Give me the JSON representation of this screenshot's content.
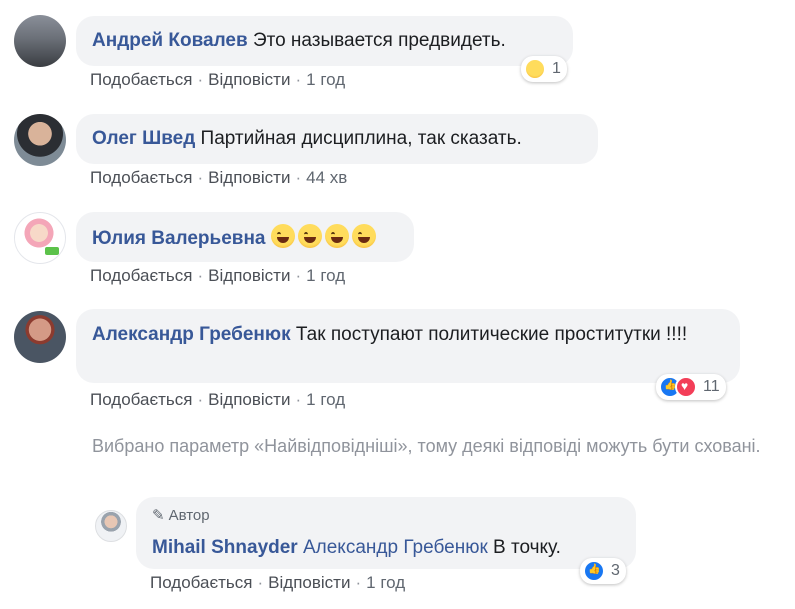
{
  "comments": [
    {
      "author": "Андрей Ковалев",
      "text": "Это называется предвидеть.",
      "like": "Подобається",
      "reply": "Відповісти",
      "time": "1 год",
      "reactions": {
        "icons": [
          "haha-icon"
        ],
        "count": "1"
      }
    },
    {
      "author": "Олег Швед",
      "text": "Партийная дисциплина, так сказать.",
      "like": "Подобається",
      "reply": "Відповісти",
      "time": "44 хв"
    },
    {
      "author": "Юлия Валерьевна",
      "text": "",
      "emoji_count": 4,
      "emoji_icon": "rolling-laughing-icon",
      "like": "Подобається",
      "reply": "Відповісти",
      "time": "1 год"
    },
    {
      "author": "Александр Гребенюк",
      "text": "Так поступают политические проститутки !!!!",
      "like": "Подобається",
      "reply": "Відповісти",
      "time": "1 год",
      "reactions": {
        "icons": [
          "like-icon",
          "love-icon"
        ],
        "count": "11"
      }
    }
  ],
  "notice": "Вибрано параметр «Найвідповідніші», тому деякі відповіді можуть бути сховані.",
  "reply": {
    "tag": "Автор",
    "author": "Mihail Shnayder",
    "mention": "Александр Гребенюк",
    "text": "В точку.",
    "like": "Подобається",
    "reply": "Відповісти",
    "time": "1 год",
    "reactions": {
      "icons": [
        "like-icon"
      ],
      "count": "3"
    }
  },
  "colors": {
    "author": "#385898",
    "bubble": "#f2f3f5",
    "meta": "#606770",
    "notice": "#90949c",
    "like": "#1877f2",
    "love": "#f33e58"
  }
}
